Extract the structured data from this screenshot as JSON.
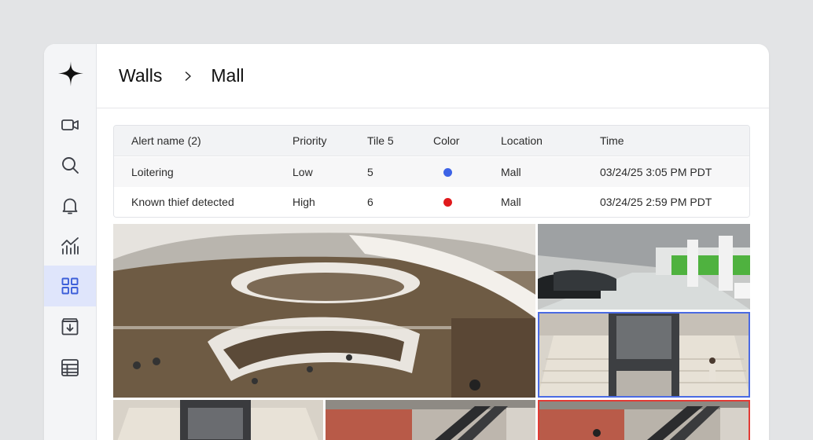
{
  "breadcrumb": {
    "root": "Walls",
    "current": "Mall"
  },
  "sidebar": {
    "items": [
      {
        "name": "cameras",
        "icon": "video-camera-icon",
        "active": false
      },
      {
        "name": "search",
        "icon": "search-icon",
        "active": false
      },
      {
        "name": "alerts",
        "icon": "bell-icon",
        "active": false
      },
      {
        "name": "analytics",
        "icon": "chart-icon",
        "active": false
      },
      {
        "name": "walls",
        "icon": "grid-icon",
        "active": true
      },
      {
        "name": "archive",
        "icon": "archive-download-icon",
        "active": false
      },
      {
        "name": "table",
        "icon": "table-icon",
        "active": false
      }
    ]
  },
  "alerts_table": {
    "headers": {
      "name": "Alert name (2)",
      "priority": "Priority",
      "tile": "Tile 5",
      "color": "Color",
      "location": "Location",
      "time": "Time"
    },
    "rows": [
      {
        "name": "Loitering",
        "priority": "Low",
        "tile": "5",
        "color": "#3d63e6",
        "location": "Mall",
        "time": "03/24/25 3:05 PM PDT"
      },
      {
        "name": "Known thief detected",
        "priority": "High",
        "tile": "6",
        "color": "#e0191c",
        "location": "Mall",
        "time": "03/24/25 2:59 PM PDT"
      }
    ]
  },
  "colors": {
    "accent": "#4a6ae3",
    "alert_red": "#e23b35",
    "active_nav_bg": "#dfe5fb"
  }
}
